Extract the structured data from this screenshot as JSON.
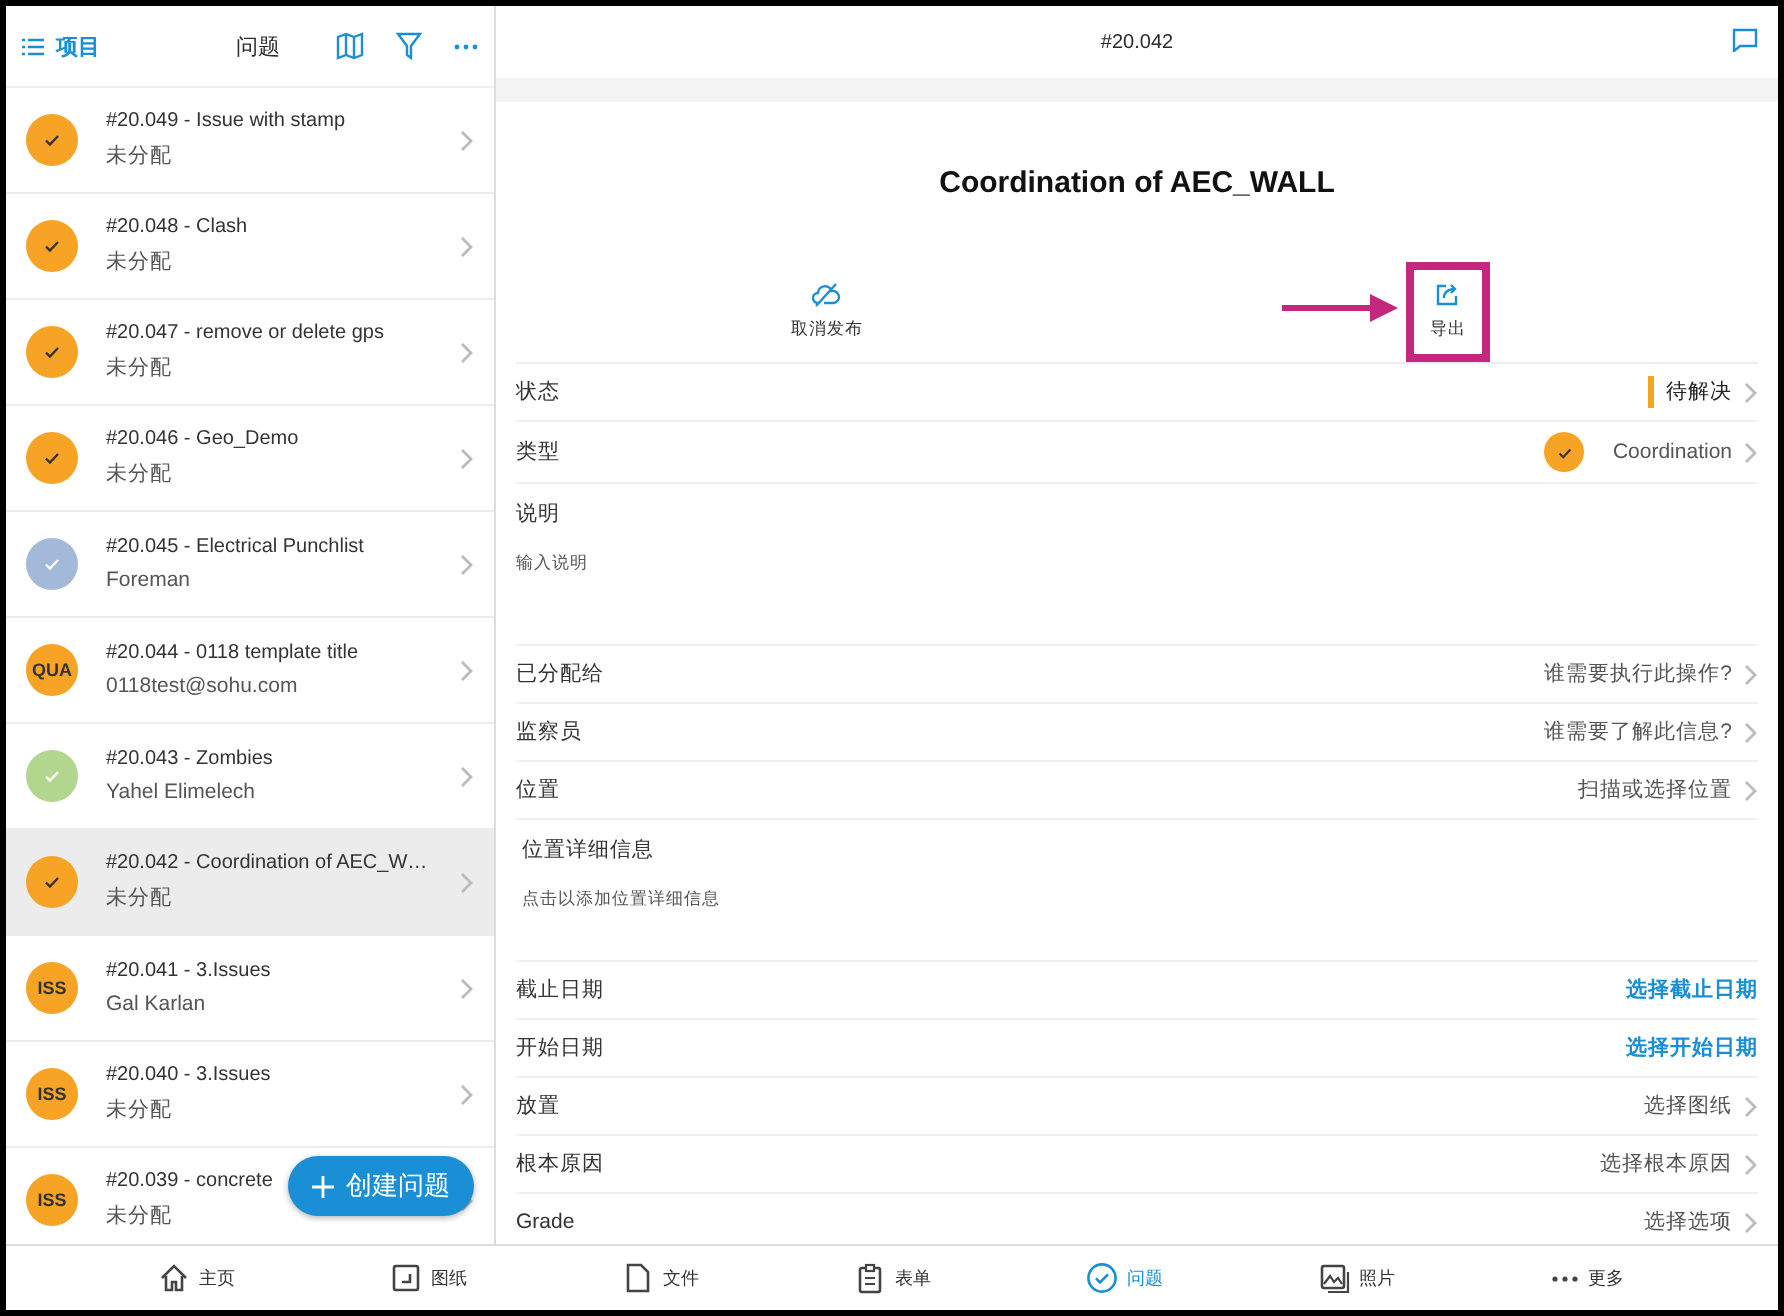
{
  "left_header": {
    "back_label": "项目",
    "title": "问题"
  },
  "issues": [
    {
      "title": "#20.049 - Issue with stamp",
      "assignee": "未分配",
      "badge": {
        "kind": "check",
        "color": "#f7a325"
      },
      "selected": false
    },
    {
      "title": "#20.048 - Clash",
      "assignee": "未分配",
      "badge": {
        "kind": "check",
        "color": "#f7a325"
      },
      "selected": false
    },
    {
      "title": "#20.047 - remove or delete gps",
      "assignee": "未分配",
      "badge": {
        "kind": "check",
        "color": "#f7a325"
      },
      "selected": false
    },
    {
      "title": "#20.046 - Geo_Demo",
      "assignee": "未分配",
      "badge": {
        "kind": "check",
        "color": "#f7a325"
      },
      "selected": false
    },
    {
      "title": "#20.045 - Electrical Punchlist",
      "assignee": "Foreman",
      "badge": {
        "kind": "check",
        "color": "#a3b9d9"
      },
      "selected": false
    },
    {
      "title": "#20.044 - 0118 template title",
      "assignee": "0118test@sohu.com",
      "badge": {
        "kind": "code",
        "code": "QUA",
        "color": "#f7a325"
      },
      "selected": false
    },
    {
      "title": "#20.043 - Zombies",
      "assignee": "Yahel Elimelech",
      "badge": {
        "kind": "check",
        "color": "#b3d68f"
      },
      "selected": false
    },
    {
      "title": "#20.042 - Coordination of AEC_W…",
      "assignee": "未分配",
      "badge": {
        "kind": "check",
        "color": "#f7a325"
      },
      "selected": true
    },
    {
      "title": "#20.041 - 3.Issues",
      "assignee": "Gal Karlan",
      "badge": {
        "kind": "code",
        "code": "ISS",
        "color": "#f7a325"
      },
      "selected": false
    },
    {
      "title": "#20.040 - 3.Issues",
      "assignee": "未分配",
      "badge": {
        "kind": "code",
        "code": "ISS",
        "color": "#f7a325"
      },
      "selected": false
    },
    {
      "title": "#20.039 - concrete",
      "assignee": "未分配",
      "badge": {
        "kind": "code",
        "code": "ISS",
        "color": "#f7a325"
      },
      "selected": false
    }
  ],
  "create_button": {
    "label": "创建问题"
  },
  "detail": {
    "header": "#20.042",
    "title": "Coordination of AEC_WALL"
  },
  "actions": [
    {
      "kind": "unpublish",
      "label": "取消发布",
      "highlighted": false
    },
    {
      "kind": "export",
      "label": "导出",
      "highlighted": true
    }
  ],
  "fields": [
    {
      "kind": "status",
      "label": "状态",
      "value": "待解决",
      "color": "#f7a325"
    },
    {
      "kind": "type",
      "label": "类型",
      "value": "Coordination",
      "color": "#f7a325"
    },
    {
      "kind": "note",
      "label": "说明",
      "placeholder": "输入说明"
    },
    {
      "kind": "picker",
      "label": "已分配给",
      "value": "谁需要执行此操作?"
    },
    {
      "kind": "picker",
      "label": "监察员",
      "value": "谁需要了解此信息?"
    },
    {
      "kind": "picker",
      "label": "位置",
      "value": "扫描或选择位置"
    },
    {
      "kind": "detail",
      "label": "位置详细信息",
      "placeholder": "点击以添加位置详细信息"
    },
    {
      "kind": "link",
      "label": "截止日期",
      "value": "选择截止日期"
    },
    {
      "kind": "link",
      "label": "开始日期",
      "value": "选择开始日期"
    },
    {
      "kind": "picker",
      "label": "放置",
      "value": "选择图纸"
    },
    {
      "kind": "picker",
      "label": "根本原因",
      "value": "选择根本原因"
    },
    {
      "kind": "picker",
      "label": "Grade",
      "value": "选择选项"
    }
  ],
  "tabs": [
    {
      "kind": "home",
      "label": "主页",
      "selected": false
    },
    {
      "kind": "drawing",
      "label": "图纸",
      "selected": false
    },
    {
      "kind": "file",
      "label": "文件",
      "selected": false
    },
    {
      "kind": "form",
      "label": "表单",
      "selected": false
    },
    {
      "kind": "issue",
      "label": "问题",
      "selected": true
    },
    {
      "kind": "photo",
      "label": "照片",
      "selected": false
    },
    {
      "kind": "more",
      "label": "更多",
      "selected": false
    }
  ]
}
